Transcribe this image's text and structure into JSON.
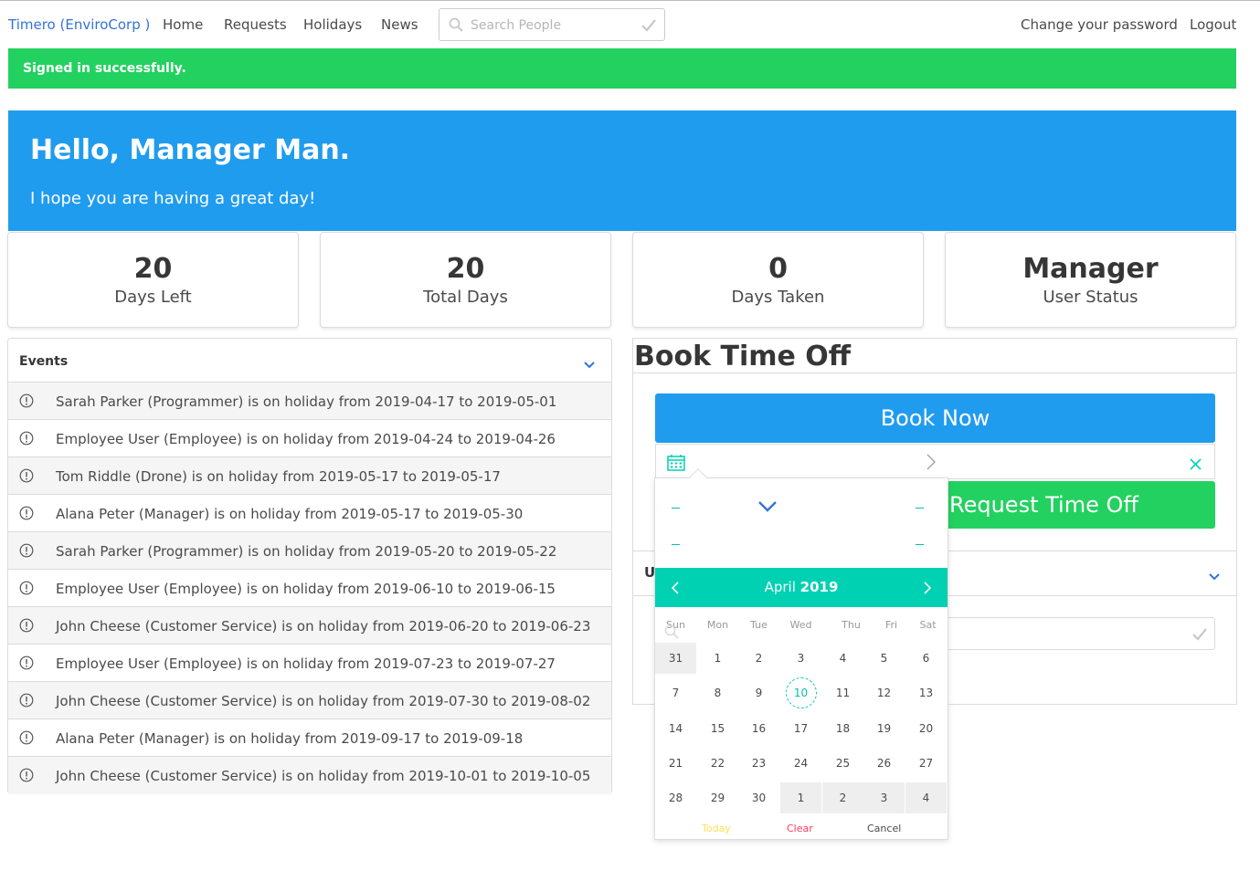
{
  "nav": {
    "brand": "Timero (EnviroCorp )",
    "links": [
      "Home",
      "Requests",
      "Holidays",
      "News"
    ],
    "search_placeholder": "Search People",
    "right_links": [
      "Change your password",
      "Logout"
    ]
  },
  "alert": {
    "message": "Signed in successfully."
  },
  "hero": {
    "title": "Hello, Manager Man.",
    "subtitle": "I hope you are having a great day!"
  },
  "stats": [
    {
      "value": "20",
      "label": "Days Left"
    },
    {
      "value": "20",
      "label": "Total Days"
    },
    {
      "value": "0",
      "label": "Days Taken"
    },
    {
      "value": "Manager",
      "label": "User Status"
    }
  ],
  "events": {
    "title": "Events",
    "items": [
      "Sarah Parker (Programmer) is on holiday from 2019-04-17 to 2019-05-01",
      "Employee User (Employee) is on holiday from 2019-04-24 to 2019-04-26",
      "Tom Riddle (Drone) is on holiday from 2019-05-17 to 2019-05-17",
      "Alana Peter (Manager) is on holiday from 2019-05-17 to 2019-05-30",
      "Sarah Parker (Programmer) is on holiday from 2019-05-20 to 2019-05-22",
      "Employee User (Employee) is on holiday from 2019-06-10 to 2019-06-15",
      "John Cheese (Customer Service) is on holiday from 2019-06-20 to 2019-06-23",
      "Employee User (Employee) is on holiday from 2019-07-23 to 2019-07-27",
      "John Cheese (Customer Service) is on holiday from 2019-07-30 to 2019-08-02",
      "Alana Peter (Manager) is on holiday from 2019-09-17 to 2019-09-18",
      "John Cheese (Customer Service) is on holiday from 2019-10-01 to 2019-10-05"
    ]
  },
  "book": {
    "title": "Book Time Off",
    "book_now": "Book Now",
    "request": "Request Time Off",
    "section_letter": "U"
  },
  "picker": {
    "month": "April",
    "year": "2019",
    "weekdays": [
      "Sun",
      "Mon",
      "Tue",
      "Wed",
      "Thu",
      "Fri",
      "Sat"
    ],
    "weeks": [
      [
        "31",
        "1",
        "2",
        "3",
        "4",
        "5",
        "6"
      ],
      [
        "7",
        "8",
        "9",
        "10",
        "11",
        "12",
        "13"
      ],
      [
        "14",
        "15",
        "16",
        "17",
        "18",
        "19",
        "20"
      ],
      [
        "21",
        "22",
        "23",
        "24",
        "25",
        "26",
        "27"
      ],
      [
        "28",
        "29",
        "30",
        "1",
        "2",
        "3",
        "4"
      ]
    ],
    "selected_day": "10",
    "today_label": "Today",
    "clear_label": "Clear",
    "cancel_label": "Cancel"
  },
  "colors": {
    "primary": "#209cee",
    "success": "#23d160",
    "turquoise": "#00d1b2",
    "link": "#3273dc",
    "today": "#ffdd57",
    "clear": "#ff3860"
  }
}
